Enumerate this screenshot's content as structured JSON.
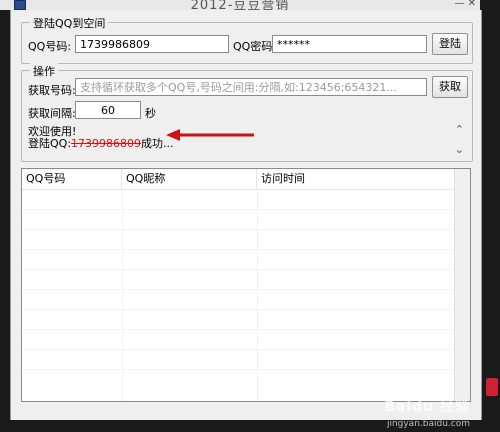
{
  "titlebar": {
    "title": "2012-豆豆营销",
    "controls": "—  ✕"
  },
  "login_group": {
    "title": "登陆QQ到空间",
    "qq_label": "QQ号码:",
    "qq_value": "1739986809",
    "pwd_label": "QQ密码:",
    "pwd_value": "******",
    "login_button": "登陆"
  },
  "ops_group": {
    "title": "操作",
    "fetch_label": "获取号码:",
    "fetch_placeholder": "支持循环获取多个QQ号,号码之间用:分隔,如:123456;654321...",
    "fetch_button": "获取",
    "interval_label": "获取间隔:",
    "interval_value": "60",
    "interval_unit": "秒",
    "log_line1": "欢迎使用!",
    "log_line2_prefix": "登陆QQ:",
    "log_line2_qq": "1739986809",
    "log_line2_suffix": "成功..."
  },
  "table": {
    "columns": [
      "QQ号码",
      "QQ昵称",
      "访问时间"
    ]
  },
  "watermark": {
    "brand": "Baidu 经验",
    "url": "jingyan.baidu.com"
  },
  "colors": {
    "annotation_red": "#cc1111",
    "window_bg": "#efefef"
  }
}
